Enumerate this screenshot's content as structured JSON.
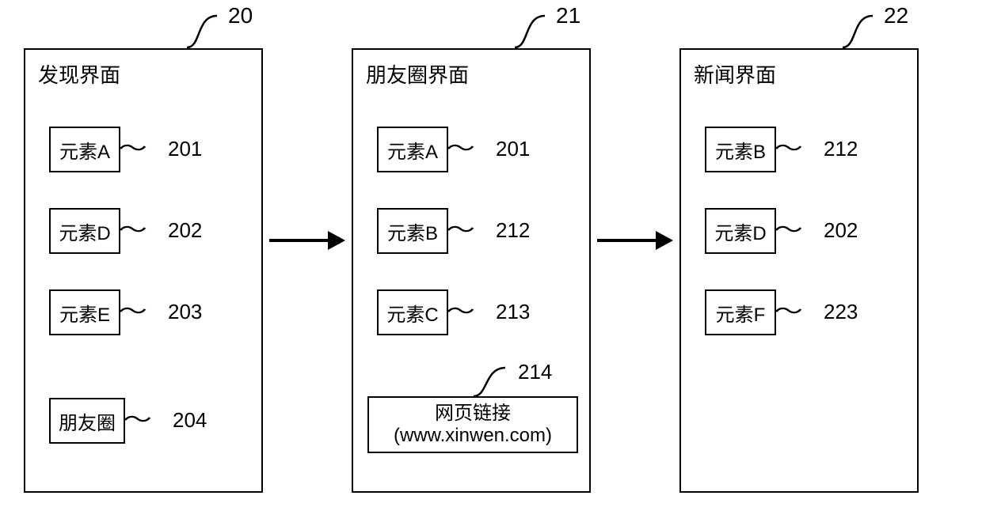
{
  "panels": [
    {
      "id": "panel-20",
      "ref": "20",
      "title": "发现界面",
      "items": [
        {
          "id": "201",
          "label": "元素A",
          "ref": "201"
        },
        {
          "id": "202",
          "label": "元素D",
          "ref": "202"
        },
        {
          "id": "203",
          "label": "元素E",
          "ref": "203"
        },
        {
          "id": "204",
          "label": "朋友圈",
          "ref": "204"
        }
      ]
    },
    {
      "id": "panel-21",
      "ref": "21",
      "title": "朋友圈界面",
      "items": [
        {
          "id": "201b",
          "label": "元素A",
          "ref": "201"
        },
        {
          "id": "212",
          "label": "元素B",
          "ref": "212"
        },
        {
          "id": "213",
          "label": "元素C",
          "ref": "213"
        }
      ],
      "link_box": {
        "ref": "214",
        "line1": "网页链接",
        "line2": "(www.xinwen.com)"
      }
    },
    {
      "id": "panel-22",
      "ref": "22",
      "title": "新闻界面",
      "items": [
        {
          "id": "212b",
          "label": "元素B",
          "ref": "212"
        },
        {
          "id": "202b",
          "label": "元素D",
          "ref": "202"
        },
        {
          "id": "223",
          "label": "元素F",
          "ref": "223"
        }
      ]
    }
  ]
}
